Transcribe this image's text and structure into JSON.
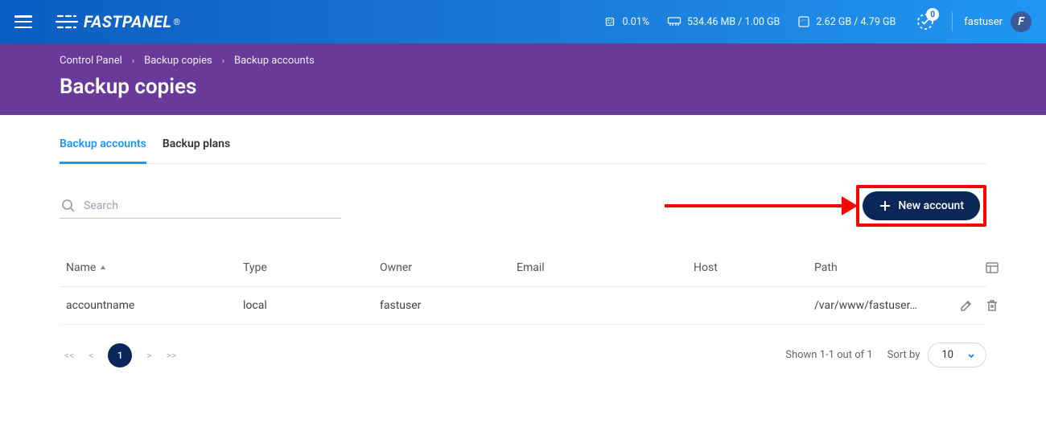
{
  "topbar": {
    "logo_text": "FASTPANEL",
    "cpu": "0.01%",
    "ram": "534.46 MB / 1.00 GB",
    "disk": "2.62 GB / 4.79 GB",
    "notif_count": "0",
    "username": "fastuser",
    "avatar_initial": "F"
  },
  "header": {
    "crumbs": [
      "Control Panel",
      "Backup copies",
      "Backup accounts"
    ],
    "title": "Backup copies"
  },
  "tabs": [
    {
      "label": "Backup accounts",
      "active": true
    },
    {
      "label": "Backup plans",
      "active": false
    }
  ],
  "search": {
    "placeholder": "Search"
  },
  "actions": {
    "new_account": "New account"
  },
  "table": {
    "columns": [
      "Name",
      "Type",
      "Owner",
      "Email",
      "Host",
      "Path"
    ],
    "rows": [
      {
        "name": "accountname",
        "type": "local",
        "owner": "fastuser",
        "email": "",
        "host": "",
        "path": "/var/www/fastuser…"
      }
    ]
  },
  "pagination": {
    "current": "1",
    "shown": "Shown 1-1 out of 1",
    "sort_label": "Sort by",
    "page_size": "10"
  }
}
